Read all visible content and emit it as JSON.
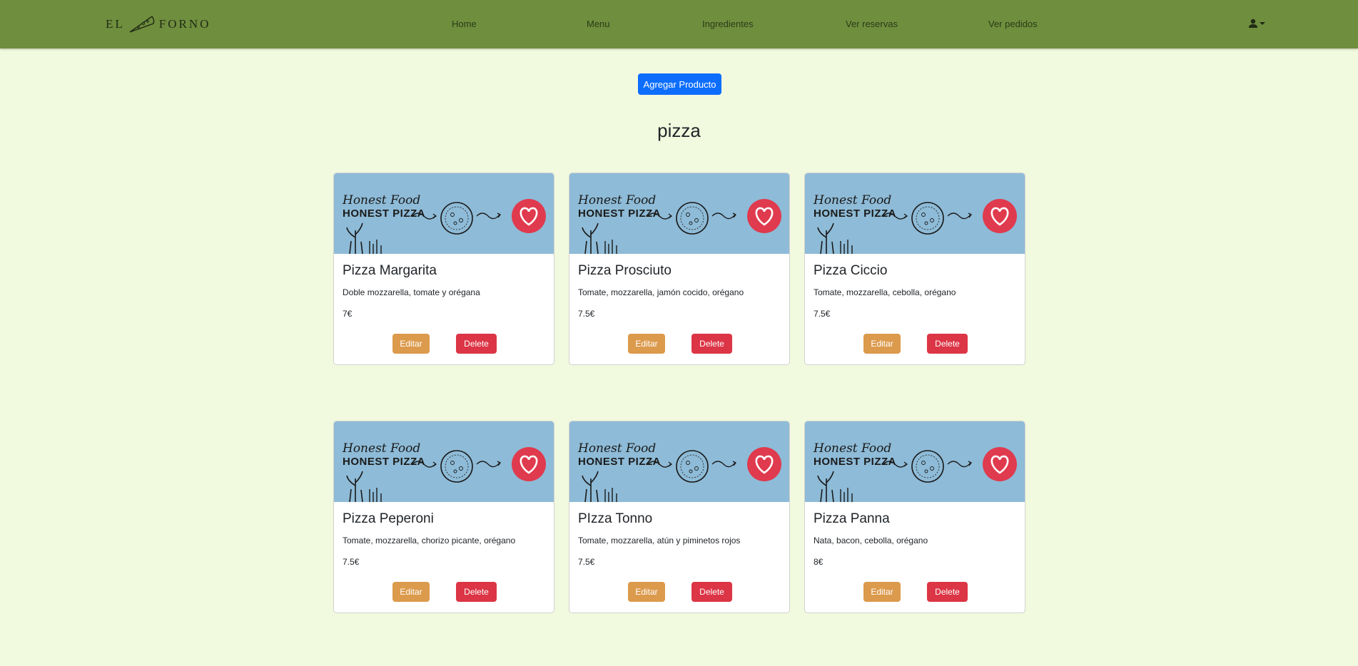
{
  "brand": {
    "left": "EL",
    "right": "FORNO"
  },
  "nav": {
    "items": [
      {
        "label": "Home"
      },
      {
        "label": "Menu"
      },
      {
        "label": "Ingredientes"
      },
      {
        "label": "Ver reservas"
      },
      {
        "label": "Ver pedidos"
      }
    ],
    "user_icon": "user-icon"
  },
  "toolbar": {
    "add_label": "Agregar Producto"
  },
  "category": "pizza",
  "banner": {
    "line1": "Honest Food",
    "line2": "HONEST PIZZA"
  },
  "actions": {
    "edit_label": "Editar",
    "delete_label": "Delete"
  },
  "products": [
    {
      "name": "Pizza Margarita",
      "description": "Doble mozzarella, tomate y orégana",
      "price": "7€"
    },
    {
      "name": "Pizza Prosciuto",
      "description": "Tomate, mozzarella, jamón cocido, orégano",
      "price": "7.5€"
    },
    {
      "name": "Pizza Ciccio",
      "description": "Tomate, mozzarella, cebolla, orégano",
      "price": "7.5€"
    },
    {
      "name": "Pizza Peperoni",
      "description": "Tomate, mozzarella, chorizo picante, orégano",
      "price": "7.5€"
    },
    {
      "name": "PIzza Tonno",
      "description": "Tomate, mozzarella, atún y piminetos rojos",
      "price": "7.5€"
    },
    {
      "name": "Pizza Panna",
      "description": "Nata, bacon, cebolla, orégano",
      "price": "8€"
    }
  ],
  "colors": {
    "navbar": "#6f8e3e",
    "background": "#f1f9de",
    "primary": "#0d6efd",
    "edit": "#dc9a4c",
    "delete": "#dc3545",
    "banner": "#8ebbd7"
  }
}
